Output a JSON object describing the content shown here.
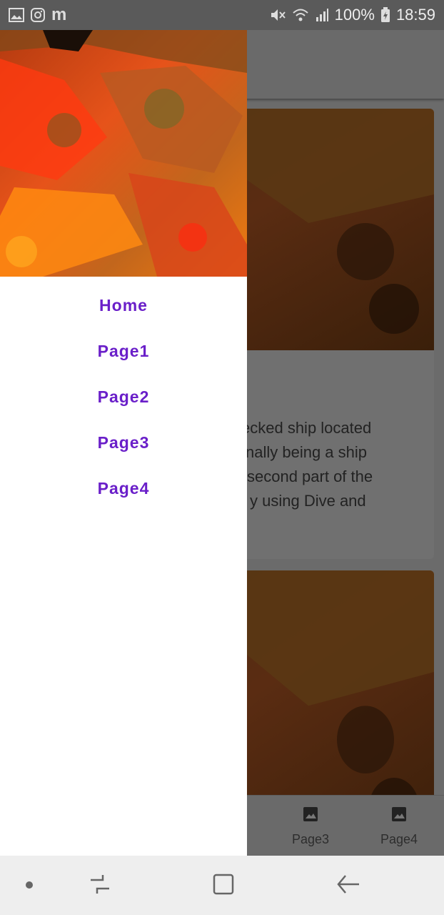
{
  "status_bar": {
    "battery": "100%",
    "time": "18:59",
    "left_icons": [
      "image-icon",
      "instagram-icon",
      "m-app-icon"
    ],
    "right_icons": [
      "mute-icon",
      "wifi-icon",
      "signal-icon",
      "battery-icon"
    ]
  },
  "card": {
    "text_lines": [
      "ecked ship located",
      "nally being a ship",
      "second part of the",
      "y using Dive and"
    ]
  },
  "bottom_nav": {
    "items": [
      {
        "label": "Page3",
        "icon": "image-icon"
      },
      {
        "label": "Page4",
        "icon": "image-icon"
      }
    ]
  },
  "drawer": {
    "menu": [
      {
        "label": "Home"
      },
      {
        "label": "Page1"
      },
      {
        "label": "Page2"
      },
      {
        "label": "Page3"
      },
      {
        "label": "Page4"
      }
    ]
  },
  "colors": {
    "menu_text": "#6a1fc9",
    "status_bar": "#5a5a5a",
    "scrim": "#6b6b6b",
    "system_nav": "#eeeeee"
  },
  "system_nav": {
    "buttons": [
      "dot-icon",
      "recents-icon",
      "home-icon",
      "back-icon"
    ]
  }
}
